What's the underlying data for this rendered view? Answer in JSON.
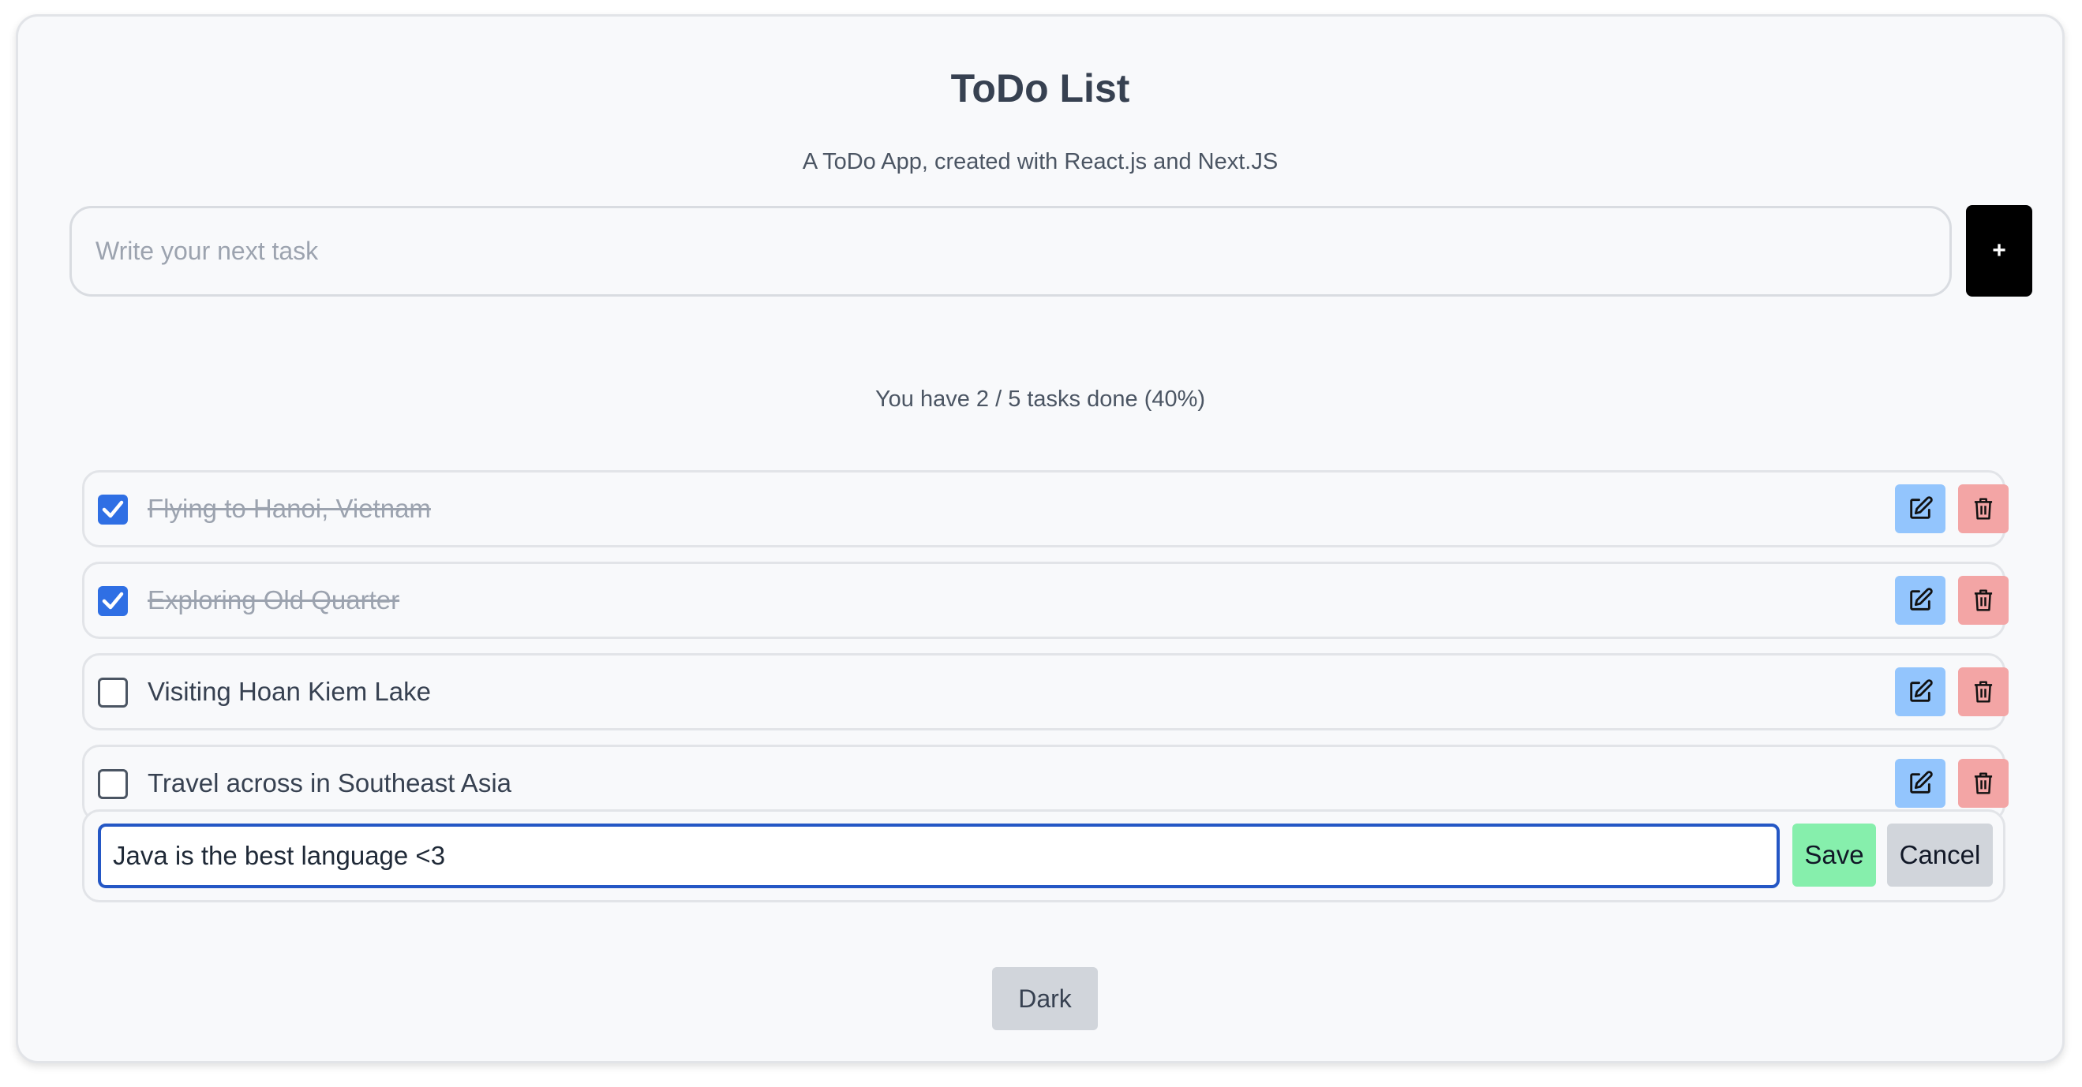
{
  "app": {
    "title": "ToDo List",
    "subtitle": "A ToDo App, created with React.js and Next.JS"
  },
  "new_task": {
    "placeholder": "Write your next task",
    "value": "",
    "add_label": "+"
  },
  "progress": {
    "text": "You have 2 / 5 tasks done (40%)",
    "done": 2,
    "total": 5,
    "percent": 40
  },
  "tasks": [
    {
      "label": "Flying to Hanoi, Vietnam",
      "done": true
    },
    {
      "label": "Exploring Old Quarter",
      "done": true
    },
    {
      "label": "Visiting Hoan Kiem Lake",
      "done": false
    },
    {
      "label": "Travel across in Southeast Asia",
      "done": false
    }
  ],
  "editing_task": {
    "value": "Java is the best language <3",
    "save_label": "Save",
    "cancel_label": "Cancel"
  },
  "theme_toggle": {
    "label": "Dark"
  },
  "colors": {
    "checkbox_checked": "#2f6fe4",
    "edit_button": "#93c5fd",
    "delete_button": "#f3a5a5",
    "save_button": "#86efac",
    "cancel_button": "#d1d5db",
    "add_button": "#000000",
    "edit_input_border": "#2457c5"
  },
  "icons": {
    "edit": "edit-icon",
    "delete": "trash-icon",
    "check": "check-icon"
  }
}
